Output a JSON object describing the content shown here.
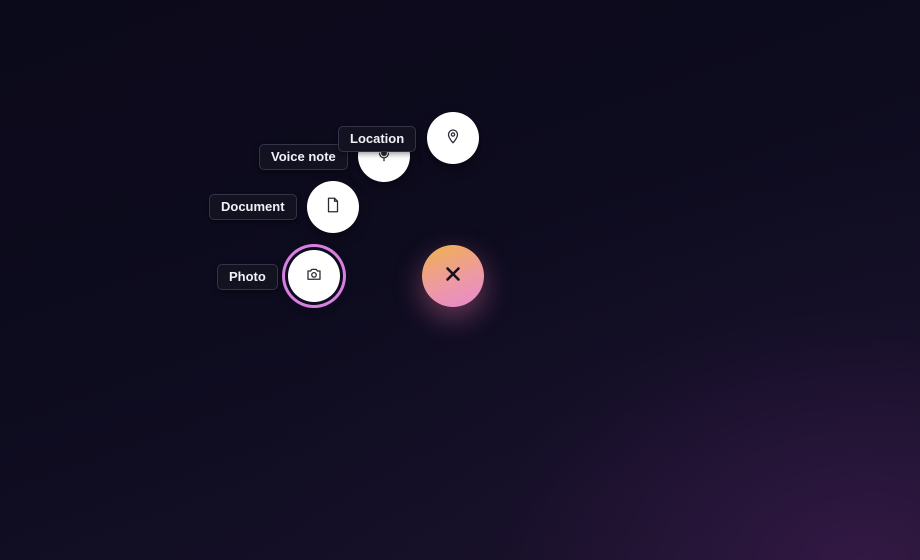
{
  "speed_dial": {
    "state": "open",
    "main_button": {
      "icon": "close-icon",
      "gradient": [
        "#efb24c",
        "#ee9aa0",
        "#e88ad0"
      ]
    },
    "actions": [
      {
        "label": "Location",
        "icon": "map-pin-icon"
      },
      {
        "label": "Voice note",
        "icon": "microphone-icon"
      },
      {
        "label": "Document",
        "icon": "document-icon"
      },
      {
        "label": "Photo",
        "icon": "camera-icon",
        "focused": true
      }
    ],
    "focus_ring_color": "#d97fe0"
  }
}
